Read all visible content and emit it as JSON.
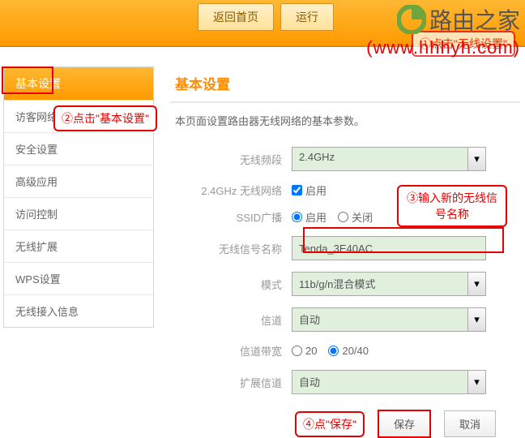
{
  "topbar": {
    "home": "返回首页",
    "run": "运行"
  },
  "watermark": {
    "title": "路由之家",
    "url": "(www.hhhyh.com)"
  },
  "sidebar": {
    "active": "基本设置",
    "items": [
      "访客网络",
      "安全设置",
      "高级应用",
      "访问控制",
      "无线扩展",
      "WPS设置",
      "无线接入信息"
    ]
  },
  "page": {
    "title": "基本设置",
    "desc": "本页面设置路由器无线网络的基本参数。"
  },
  "form": {
    "band": {
      "label": "无线频段",
      "value": "2.4GHz"
    },
    "wireless": {
      "label": "2.4GHz 无线网络",
      "enable": "启用"
    },
    "ssidbc": {
      "label": "SSID广播",
      "on": "启用",
      "off": "关闭"
    },
    "ssid": {
      "label": "无线信号名称",
      "value": "Tenda_3E40AC"
    },
    "mode": {
      "label": "模式",
      "value": "11b/g/n混合模式"
    },
    "channel": {
      "label": "信道",
      "value": "自动"
    },
    "bw": {
      "label": "信道带宽",
      "v20": "20",
      "v2040": "20/40"
    },
    "extch": {
      "label": "扩展信道",
      "value": "自动"
    }
  },
  "buttons": {
    "save": "保存",
    "cancel": "取消"
  },
  "callouts": {
    "c1": "①点击\"无线设置\"",
    "c2": "②点击\"基本设置\"",
    "c3": "③输入新的无线信号名称",
    "c4": "④点\"保存\""
  }
}
